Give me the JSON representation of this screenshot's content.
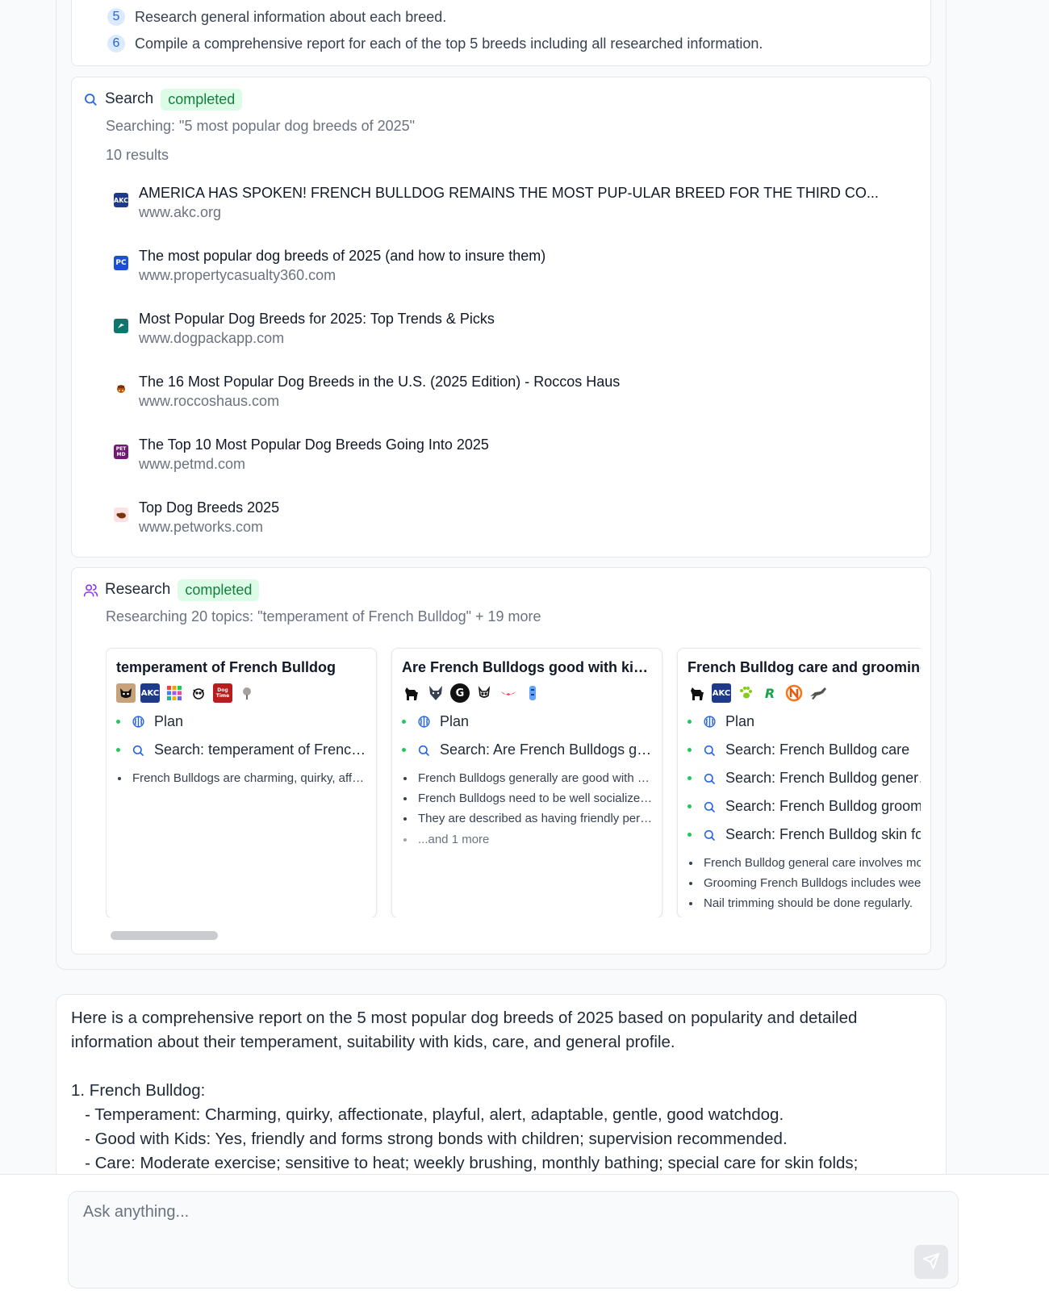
{
  "plan": {
    "steps": [
      {
        "num": "5",
        "text": "Research general information about each breed."
      },
      {
        "num": "6",
        "text": "Compile a comprehensive report for each of the top 5 breeds including all researched information."
      }
    ]
  },
  "search": {
    "title": "Search",
    "status": "completed",
    "query": "Searching: \"5 most popular dog breeds of 2025\"",
    "count": "10 results",
    "results": [
      {
        "favicon": "AKC",
        "title": "AMERICA HAS SPOKEN! FRENCH BULLDOG REMAINS THE MOST PUP-ULAR BREED FOR THE THIRD CO...",
        "url": "www.akc.org"
      },
      {
        "favicon": "PC",
        "title": "The most popular dog breeds of 2025 (and how to insure them)",
        "url": "www.propertycasualty360.com"
      },
      {
        "favicon": "dog-pack-icon",
        "title": "Most Popular Dog Breeds for 2025: Top Trends & Picks",
        "url": "www.dogpackapp.com"
      },
      {
        "favicon": "roccos-icon",
        "title": "The 16 Most Popular Dog Breeds in the U.S. (2025 Edition) - Roccos Haus",
        "url": "www.roccoshaus.com"
      },
      {
        "favicon": "PET MD",
        "title": "The Top 10 Most Popular Dog Breeds Going Into 2025",
        "url": "www.petmd.com"
      },
      {
        "favicon": "petworks-icon",
        "title": "Top Dog Breeds 2025",
        "url": "www.petworks.com"
      }
    ]
  },
  "research": {
    "title": "Research",
    "status": "completed",
    "subtitle": "Researching 20 topics: \"temperament of French Bulldog\" + 19 more",
    "cards": [
      {
        "title": "temperament of French Bulldog",
        "favicons": [
          "AKC",
          "Dog Time"
        ],
        "actions": [
          {
            "icon": "brain-icon",
            "text": "Plan"
          },
          {
            "icon": "search-icon",
            "text": "Search: temperament of French Bulldog"
          }
        ],
        "bullets": [
          "French Bulldogs are charming, quirky, affectionate and playful."
        ],
        "more": ""
      },
      {
        "title": "Are French Bulldogs good with kids?",
        "favicons": [
          "G"
        ],
        "actions": [
          {
            "icon": "brain-icon",
            "text": "Plan"
          },
          {
            "icon": "search-icon",
            "text": "Search: Are French Bulldogs good with kids?"
          }
        ],
        "bullets": [
          "French Bulldogs generally are good with children.",
          "French Bulldogs need to be well socialized early.",
          "They are described as having friendly personalities."
        ],
        "more": "...and 1 more"
      },
      {
        "title": "French Bulldog care and grooming",
        "favicons": [
          "AKC",
          "R"
        ],
        "actions": [
          {
            "icon": "brain-icon",
            "text": "Plan"
          },
          {
            "icon": "search-icon",
            "text": "Search: French Bulldog care"
          },
          {
            "icon": "search-icon",
            "text": "Search: French Bulldog general care"
          },
          {
            "icon": "search-icon",
            "text": "Search: French Bulldog grooming"
          },
          {
            "icon": "search-icon",
            "text": "Search: French Bulldog skin folds"
          }
        ],
        "bullets": [
          "French Bulldog general care involves moderate exercise.",
          "Grooming French Bulldogs includes weekly brushing.",
          "Nail trimming should be done regularly."
        ],
        "more": ""
      }
    ]
  },
  "answer": {
    "text": "Here is a comprehensive report on the 5 most popular dog breeds of 2025 based on popularity and detailed information about their temperament, suitability with kids, care, and general profile.\n\n1. French Bulldog:\n   - Temperament: Charming, quirky, affectionate, playful, alert, adaptable, gentle, good watchdog.\n   - Good with Kids: Yes, friendly and forms strong bonds with children; supervision recommended.\n   - Care: Moderate exercise; sensitive to heat; weekly brushing, monthly bathing; special care for skin folds;"
  },
  "composer": {
    "placeholder": "Ask anything..."
  },
  "colors": {
    "accent": "#2563eb",
    "success_bg": "#dcfce7",
    "success_text": "#15803d",
    "research_icon": "#9333ea"
  }
}
